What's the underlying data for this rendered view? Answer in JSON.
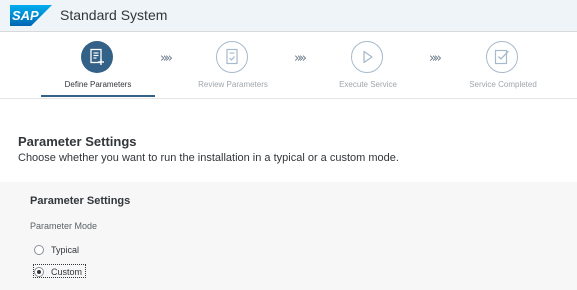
{
  "header": {
    "logo_text": "SAP",
    "title": "Standard System"
  },
  "wizard": {
    "steps": [
      {
        "label": "Define Parameters",
        "icon": "form-add-icon",
        "state": "active"
      },
      {
        "label": "Review Parameters",
        "icon": "review-document-icon",
        "state": "inactive"
      },
      {
        "label": "Execute Service",
        "icon": "play-icon",
        "state": "inactive"
      },
      {
        "label": "Service Completed",
        "icon": "check-document-icon",
        "state": "inactive"
      }
    ],
    "separator": "»»"
  },
  "section": {
    "title": "Parameter Settings",
    "description": "Choose whether you want to run the installation in a typical or a custom mode."
  },
  "panel": {
    "title": "Parameter Settings",
    "mode_label": "Parameter Mode",
    "options": [
      {
        "label": "Typical",
        "selected": false
      },
      {
        "label": "Custom",
        "selected": true
      }
    ]
  },
  "colors": {
    "accent": "#346187",
    "shell_bg": "#eff4f9",
    "panel_bg": "#f7f7f7"
  }
}
